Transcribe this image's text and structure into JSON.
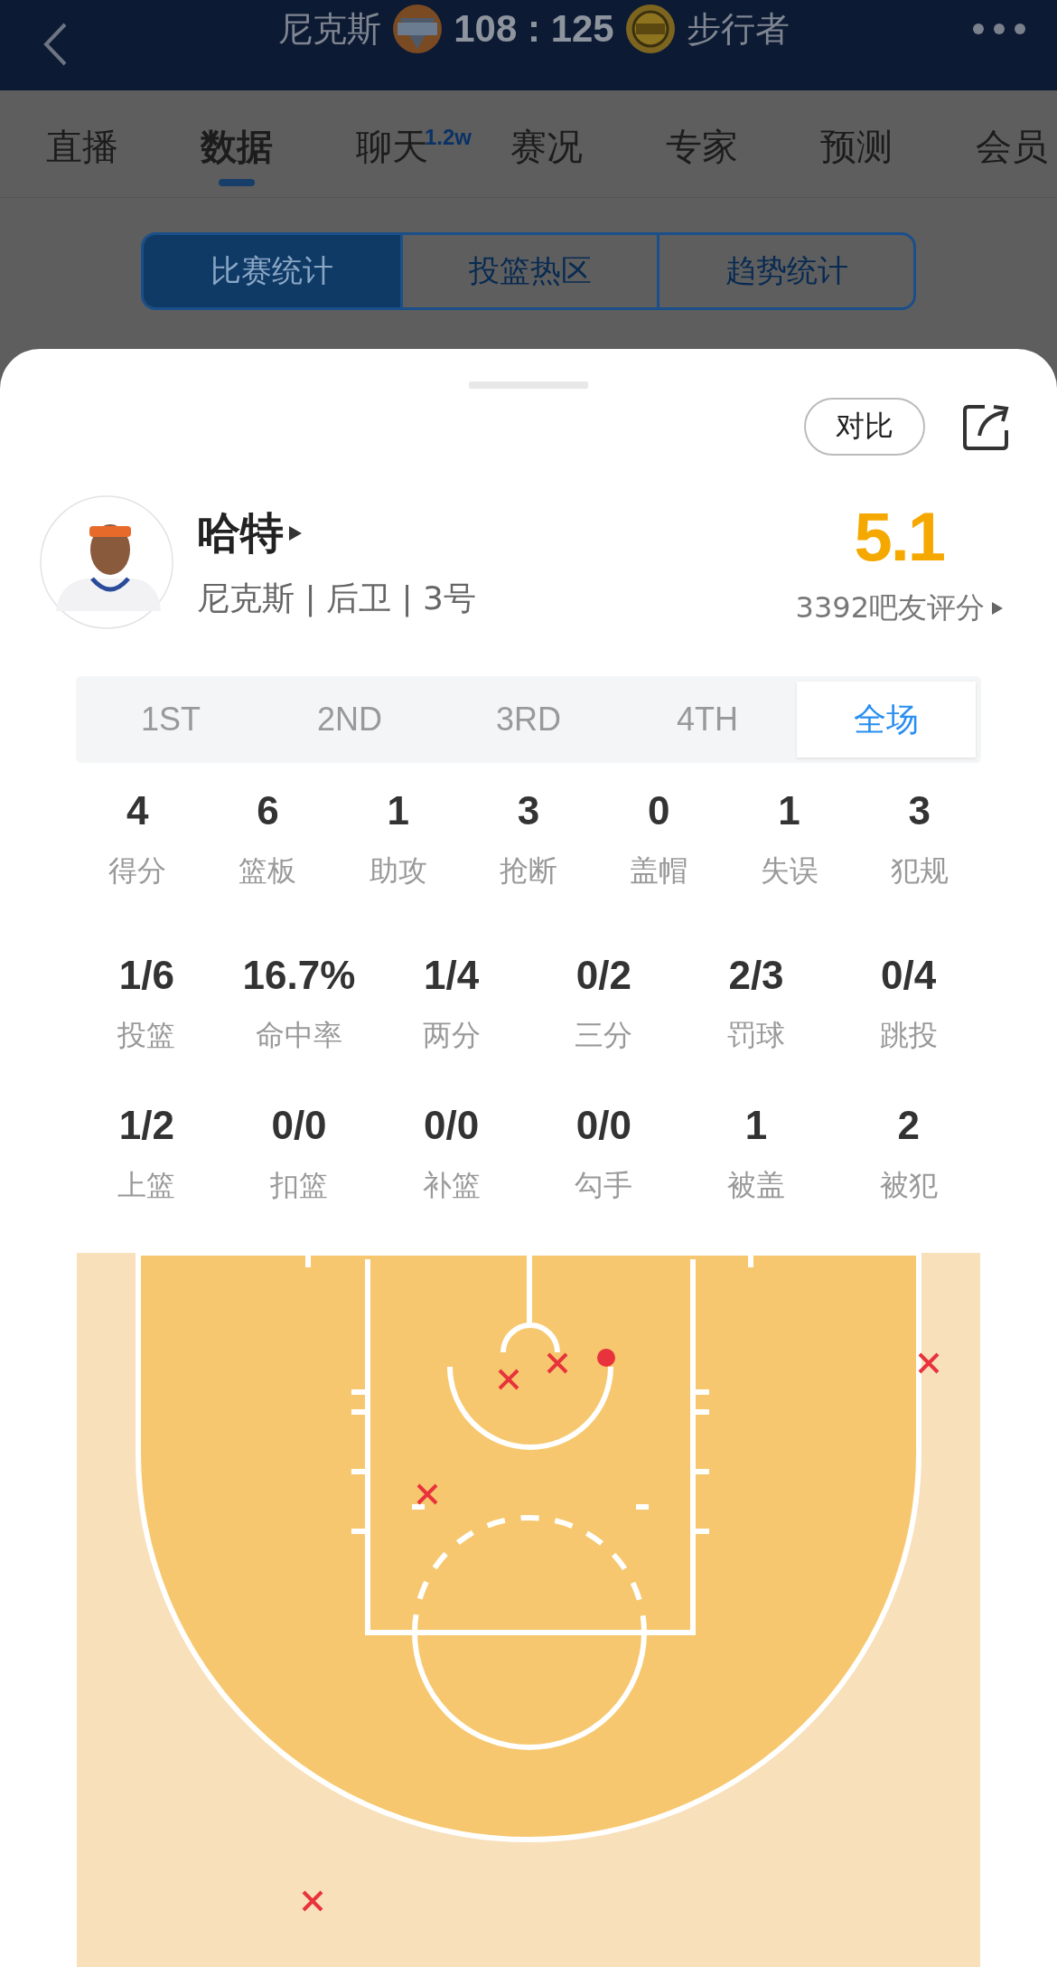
{
  "header": {
    "home_team": "尼克斯",
    "score": "108 : 125",
    "away_team": "步行者"
  },
  "tabs": [
    {
      "label": "直播",
      "selected": false
    },
    {
      "label": "数据",
      "selected": true
    },
    {
      "label": "聊天",
      "badge": "1.2w",
      "selected": false
    },
    {
      "label": "赛况",
      "selected": false
    },
    {
      "label": "专家",
      "selected": false
    },
    {
      "label": "预测",
      "selected": false
    },
    {
      "label": "会员",
      "selected": false
    }
  ],
  "segments": [
    {
      "label": "比赛统计",
      "selected": true
    },
    {
      "label": "投篮热区",
      "selected": false
    },
    {
      "label": "趋势统计",
      "selected": false
    }
  ],
  "compare_button": "对比",
  "player": {
    "name": "哈特",
    "info": "尼克斯 | 后卫 | 3号",
    "rating": "5.1",
    "rating_count": "3392吧友评分"
  },
  "periods": [
    {
      "label": "1ST",
      "selected": false
    },
    {
      "label": "2ND",
      "selected": false
    },
    {
      "label": "3RD",
      "selected": false
    },
    {
      "label": "4TH",
      "selected": false
    },
    {
      "label": "全场",
      "selected": true
    }
  ],
  "stats_main": [
    {
      "value": "4",
      "label": "得分"
    },
    {
      "value": "6",
      "label": "篮板"
    },
    {
      "value": "1",
      "label": "助攻"
    },
    {
      "value": "3",
      "label": "抢断"
    },
    {
      "value": "0",
      "label": "盖帽"
    },
    {
      "value": "1",
      "label": "失误"
    },
    {
      "value": "3",
      "label": "犯规"
    }
  ],
  "stats_shooting": [
    {
      "value": "1/6",
      "label": "投篮"
    },
    {
      "value": "16.7%",
      "label": "命中率"
    },
    {
      "value": "1/4",
      "label": "两分"
    },
    {
      "value": "0/2",
      "label": "三分"
    },
    {
      "value": "2/3",
      "label": "罚球"
    },
    {
      "value": "0/4",
      "label": "跳投"
    }
  ],
  "stats_other": [
    {
      "value": "1/2",
      "label": "上篮"
    },
    {
      "value": "0/0",
      "label": "扣篮"
    },
    {
      "value": "0/0",
      "label": "补篮"
    },
    {
      "value": "0/0",
      "label": "勾手"
    },
    {
      "value": "1",
      "label": "被盖"
    },
    {
      "value": "2",
      "label": "被犯"
    }
  ],
  "shot_chart": {
    "shots": [
      {
        "made": true
      },
      {
        "made": false
      },
      {
        "made": false
      },
      {
        "made": false
      },
      {
        "made": false
      },
      {
        "made": false
      }
    ]
  }
}
